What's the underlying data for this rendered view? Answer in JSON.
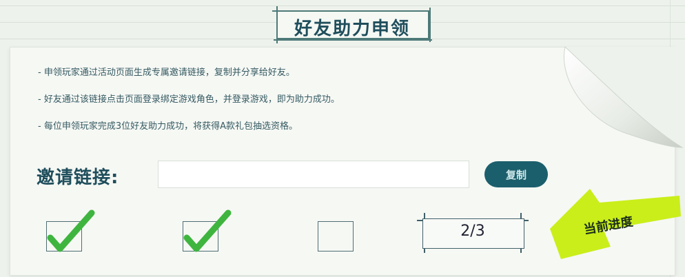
{
  "title": "好友助力申领",
  "rules": [
    "- 申领玩家通过活动页面生成专属邀请链接，复制并分享给好友。",
    "- 好友通过该链接点击页面登录绑定游戏角色，并登录游戏，即为助力成功。",
    "- 每位申领玩家完成3位好友助力成功，将获得A款礼包抽选资格。"
  ],
  "invite": {
    "label": "邀请链接:",
    "value": "",
    "copy_label": "复制"
  },
  "progress": {
    "slots": [
      {
        "checked": true
      },
      {
        "checked": true
      },
      {
        "checked": false
      }
    ],
    "text": "2/3",
    "done": 2,
    "total": 3,
    "current_label": "当前进度"
  },
  "colors": {
    "accent": "#1c5f6c",
    "check": "#3fb53f",
    "tag": "#c9ee1a"
  }
}
